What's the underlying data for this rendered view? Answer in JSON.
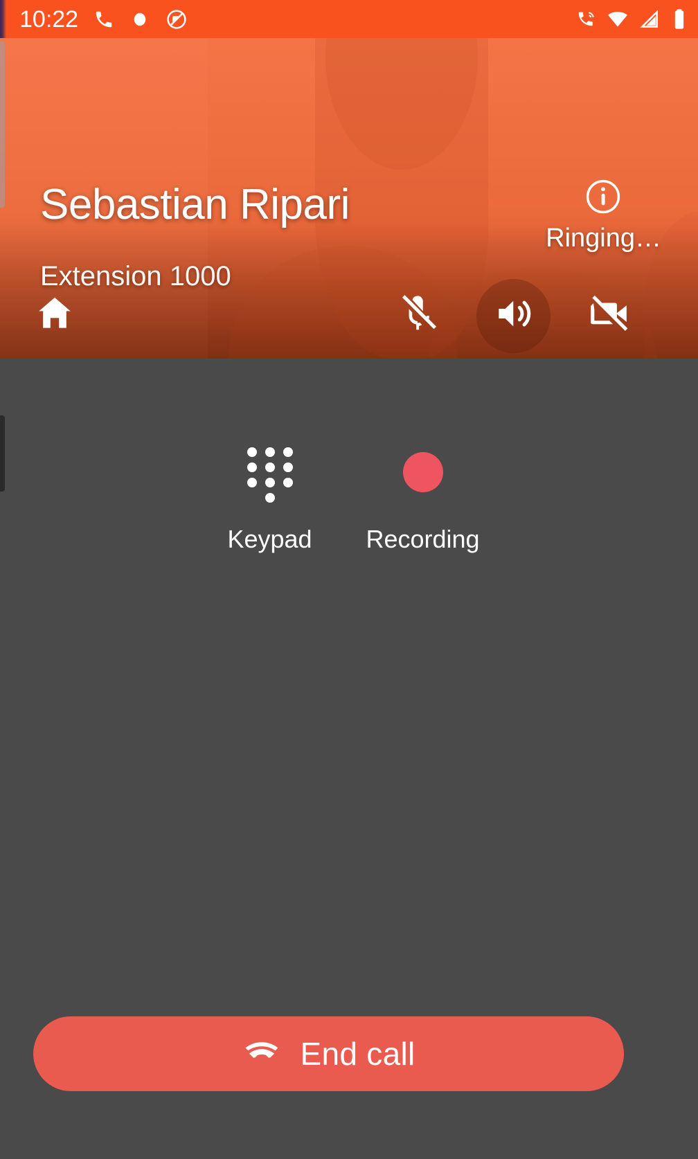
{
  "status_bar": {
    "clock": "10:22",
    "left_icons": [
      "phone-call-icon",
      "record-dot-icon",
      "dnd-icon"
    ],
    "right_icons": [
      "call-active-icon",
      "wifi-icon",
      "cellular-signal-icon",
      "battery-icon"
    ],
    "background_color": "#f9521e"
  },
  "call": {
    "caller_name": "Sebastian Ripari",
    "caller_subtitle": "Extension 1000",
    "call_state": "Ringing…",
    "info_icon": "info-circle-icon",
    "header_accent_color": "#ef6b3c"
  },
  "header_controls": [
    {
      "name": "home",
      "icon": "home-icon",
      "active": false
    },
    {
      "name": "mute",
      "icon": "microphone-off-icon",
      "active": false
    },
    {
      "name": "speaker",
      "icon": "speaker-on-icon",
      "active": true
    },
    {
      "name": "video",
      "icon": "video-off-icon",
      "active": false
    }
  ],
  "features": [
    {
      "name": "keypad",
      "label": "Keypad",
      "icon": "dialpad-icon"
    },
    {
      "name": "recording",
      "label": "Recording",
      "icon": "record-circle-icon",
      "color": "#ef5560"
    }
  ],
  "end_call": {
    "label": "End call",
    "icon": "call-end-icon",
    "color": "#ea5b4f"
  },
  "theme": {
    "body_background": "#4a4a4a",
    "text_color": "#ffffff"
  }
}
